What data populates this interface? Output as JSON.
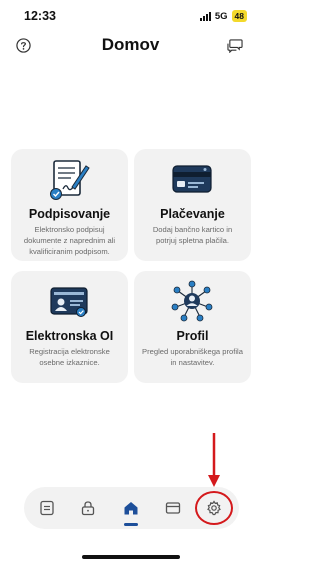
{
  "status": {
    "time": "12:33",
    "network": "5G",
    "battery": "48"
  },
  "header": {
    "title": "Domov",
    "left_icon": "help-circle-icon",
    "right_icon": "chat-bubbles-icon"
  },
  "cards": [
    {
      "title": "Podpisovanje",
      "description": "Elektronsko podpisuj dokumente z naprednim ali kvalificiranim podpisom.",
      "icon": "document-sign-icon"
    },
    {
      "title": "Plačevanje",
      "description": "Dodaj bančno kartico in potrjuj spletna plačila.",
      "icon": "bank-card-icon"
    },
    {
      "title": "Elektronska OI",
      "description": "Registracija elektronske osebne izkaznice.",
      "icon": "id-card-icon"
    },
    {
      "title": "Profil",
      "description": "Pregled uporabniškega profila in nastavitev.",
      "icon": "profile-network-icon"
    }
  ],
  "tabs": [
    {
      "icon": "list-icon",
      "active": false
    },
    {
      "icon": "lock-icon",
      "active": false
    },
    {
      "icon": "home-icon",
      "active": true
    },
    {
      "icon": "card-icon",
      "active": false
    },
    {
      "icon": "gear-icon",
      "active": false,
      "highlighted": true
    }
  ],
  "colors": {
    "accent": "#1d4f9a",
    "highlight": "#d4191c",
    "card_bg": "#f2f2f2",
    "battery": "#f3d92b"
  }
}
